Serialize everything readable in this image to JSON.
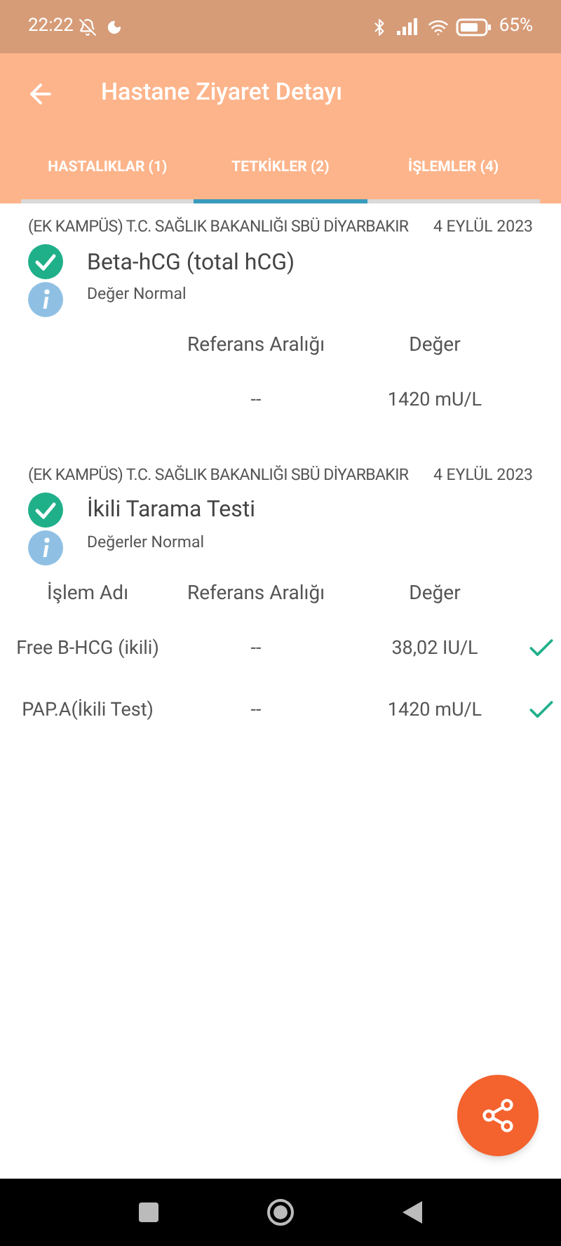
{
  "status_bar": {
    "time": "22:22",
    "battery": "65%"
  },
  "header": {
    "title": "Hastane Ziyaret Detayı"
  },
  "tabs": [
    {
      "label": "HASTALIKLAR (1)",
      "selected": false
    },
    {
      "label": "TETKİKLER (2)",
      "selected": true
    },
    {
      "label": "İŞLEMLER (4)",
      "selected": false
    }
  ],
  "tests": [
    {
      "hospital": "(EK KAMPÜS) T.C. SAĞLIK BAKANLIĞI SBÜ DİYARBAKIR",
      "date": "4 EYLÜL 2023",
      "name": "Beta-hCG (total hCG)",
      "status": "Değer Normal",
      "kind": "single",
      "columns": [
        "Referans Aralığı",
        "Değer"
      ],
      "rows": [
        {
          "reference": "--",
          "value": "1420 mU/L",
          "checked": false
        }
      ]
    },
    {
      "hospital": "(EK KAMPÜS) T.C. SAĞLIK BAKANLIĞI SBÜ DİYARBAKIR",
      "date": "4 EYLÜL 2023",
      "name": "İkili Tarama Testi",
      "status": "Değerler Normal",
      "kind": "multi",
      "columns": [
        "İşlem Adı",
        "Referans Aralığı",
        "Değer"
      ],
      "rows": [
        {
          "name": "Free B-HCG (ikili)",
          "reference": "--",
          "value": "38,02 IU/L",
          "checked": true
        },
        {
          "name": "PAP.A(İkili Test)",
          "reference": "--",
          "value": "1420 mU/L",
          "checked": true
        }
      ]
    }
  ]
}
